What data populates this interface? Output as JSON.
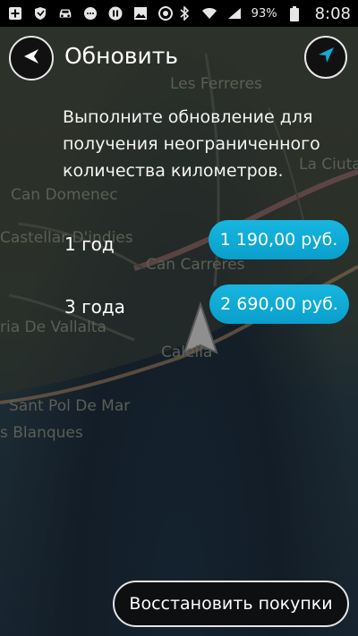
{
  "status_bar": {
    "battery": "93%",
    "time": "8:08"
  },
  "map": {
    "labels": {
      "les_ferreres": "Les Ferreres",
      "la_ciutat": "La Ciutat Ja",
      "can_domenec": "Can Domenec",
      "castellar": "Castellar D'indies",
      "can_carreres": "Can Carreres",
      "vallalta": "ria De Vallalta",
      "calella": "Calella",
      "sant_pol": "Sant Pol De Mar",
      "blanques": "s Blanques"
    }
  },
  "header": {
    "title": "Обновить"
  },
  "description": "Выполните обновление для получения неограниченного количества километров.",
  "plans": [
    {
      "label": "1 год",
      "price": "1 190,00 руб."
    },
    {
      "label": "3 года",
      "price": "2 690,00 руб."
    }
  ],
  "restore_label": "Восстановить покупки",
  "colors": {
    "accent": "#12aad8",
    "background": "#1c2a33"
  }
}
